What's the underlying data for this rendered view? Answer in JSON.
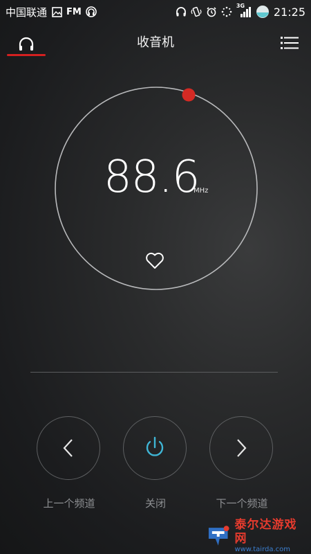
{
  "status_bar": {
    "carrier": "中国联通",
    "fm": "FM",
    "network": "3G",
    "time": "21:25"
  },
  "header": {
    "title": "收音机"
  },
  "tuner": {
    "frequency": "88.6",
    "unit": "MHz"
  },
  "controls": {
    "prev_label": "上一个频道",
    "power_label": "关闭",
    "next_label": "下一个频道"
  },
  "watermark": {
    "name": "泰尔达游戏网",
    "url": "www.tairda.com"
  },
  "colors": {
    "accent_red": "#d32020",
    "power_cyan": "#3fb6d6"
  },
  "icons": {
    "header_left": "headphones-icon",
    "header_right": "menu-icon",
    "favorite": "heart-outline-icon",
    "prev": "chevron-left-icon",
    "power": "power-icon",
    "next": "chevron-right-icon"
  }
}
